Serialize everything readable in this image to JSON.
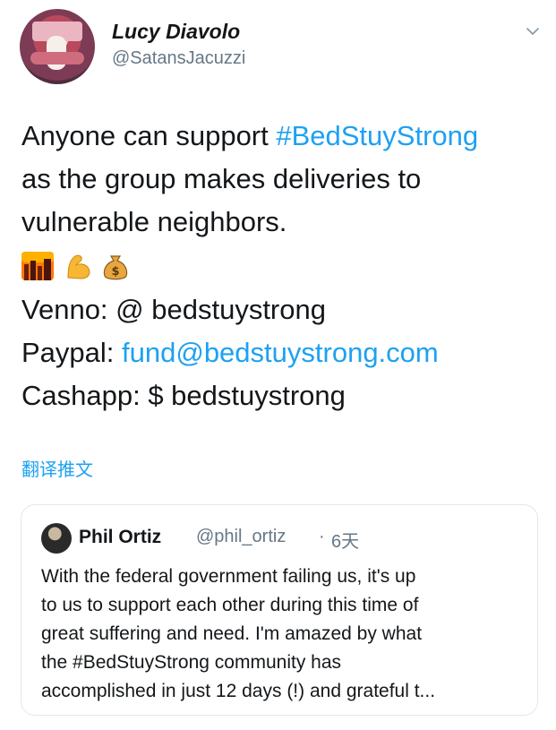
{
  "header": {
    "display_name": "Lucy Diavolo",
    "handle": "@SatansJacuzzi"
  },
  "tweet": {
    "line1_prefix": "Anyone can support ",
    "line1_hashtag": "#BedStuyStrong",
    "line2": "as the group makes deliveries to",
    "line3": "vulnerable neighbors.",
    "emojis": [
      "city-sunset-icon",
      "flexed-biceps-icon",
      "money-bag-icon"
    ],
    "venmo": "Venno: @ bedstuystrong",
    "paypal_label": "Paypal: ",
    "paypal_link": "fund@bedstuystrong.com",
    "cashapp": "Cashapp: $ bedstuystrong"
  },
  "translate_label": "翻译推文",
  "quote": {
    "name": "Phil Ortiz",
    "handle": "@phil_ortiz",
    "separator": "·",
    "time": "6天",
    "text_lines": [
      "With the federal government failing us, it's up",
      "to us to support each other during this time of",
      "great suffering and need. I'm amazed by what",
      "the #BedStuyStrong community has",
      "accomplished in just 12 days (!) and grateful t..."
    ]
  },
  "colors": {
    "link": "#1da1f2",
    "text": "#14171a",
    "muted": "#657786",
    "border": "#e1e8ed"
  }
}
